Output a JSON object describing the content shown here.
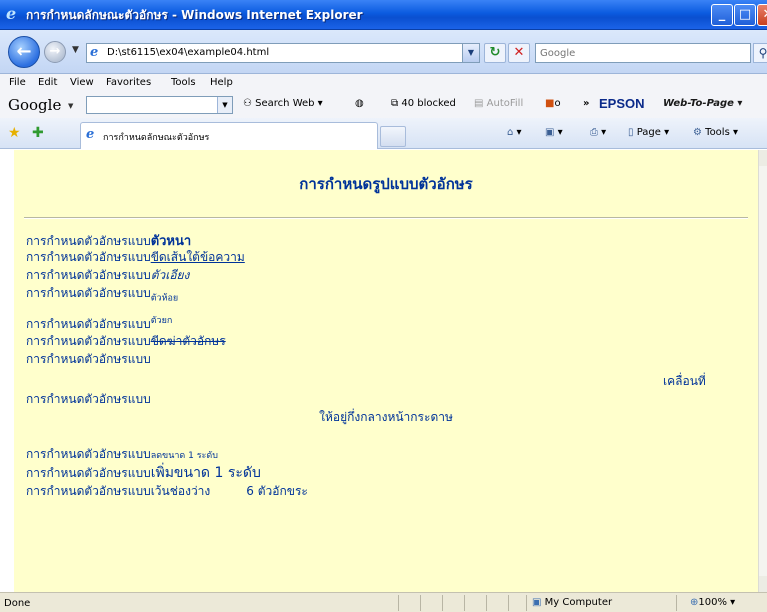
{
  "window": {
    "title": "การกำหนดลักษณะตัวอักษร - Windows Internet Explorer"
  },
  "address_bar": {
    "url": "D:\\st6115\\ex04\\example04.html"
  },
  "search": {
    "placeholder": "Google"
  },
  "menu": {
    "items": [
      "File",
      "Edit",
      "View",
      "Favorites",
      "Tools",
      "Help"
    ]
  },
  "google_toolbar": {
    "logo": "Google",
    "search_web": "Search Web",
    "blocked": "40 blocked",
    "autofill": "AutoFill",
    "o_label": "o",
    "more": "»",
    "epson": "EPSON",
    "web_to_page": "Web-To-Page"
  },
  "tabs": {
    "active_label": "การกำหนดลักษณะตัวอักษร"
  },
  "command_bar": {
    "page": "Page",
    "tools": "Tools"
  },
  "content": {
    "heading": "การกำหนดรูปแบบตัวอักษร",
    "prefix": "การกำหนดตัวอักษรแบบ",
    "bold_text": "ตัวหนา",
    "underline_text": "ขีดเส้นใต้ข้อความ",
    "italic_text": "ตัวเอียง",
    "subscript_text": "ตัวห้อย",
    "superscript_text": "ตัวยก",
    "strike_text": "ขีดฆ่าตัวอักษร",
    "marquee_text": "เคลื่อนที่",
    "center_text": "ให้อยู่กึ่งกลางหน้ากระดาษ",
    "smaller_text": "ลดขนาด 1 ระดับ",
    "bigger_text": "เพิ่มขนาด 1 ระดับ",
    "spacing_label": "เว้นช่องว่าง",
    "spacing_value": "6 ตัวอักขระ"
  },
  "status": {
    "text": "Done",
    "zone": "My Computer",
    "zoom": "100%"
  }
}
